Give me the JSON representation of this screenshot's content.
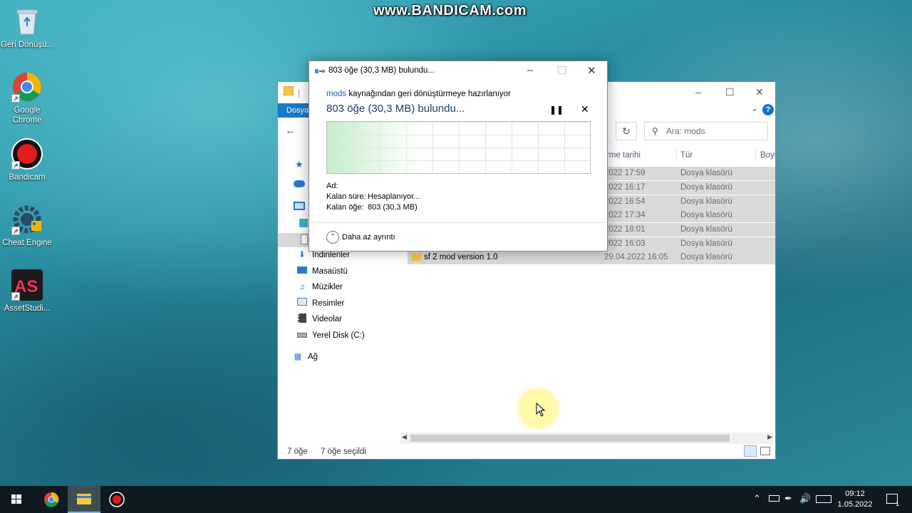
{
  "watermark": "www.BANDICAM.com",
  "desktop": {
    "icons": [
      {
        "label": "Geri Dönüşü...",
        "icon": "recycle-bin-icon"
      },
      {
        "label": "Google Chrome",
        "icon": "chrome-icon"
      },
      {
        "label": "Bandicam",
        "icon": "bandicam-icon"
      },
      {
        "label": "Cheat Engine",
        "icon": "cheat-engine-icon"
      },
      {
        "label": "AssetStudi...",
        "icon": "assetstudio-icon"
      }
    ]
  },
  "explorer": {
    "ribbon_tab": "Dosya",
    "search_placeholder": "Ara: mods",
    "columns": {
      "date": "rme tarihi",
      "type": "Tür",
      "size": "Boyu"
    },
    "rows": [
      {
        "name": "",
        "date": "2022 17:59",
        "type": "Dosya klasörü"
      },
      {
        "name": "",
        "date": "2022 16:17",
        "type": "Dosya klasörü"
      },
      {
        "name": "",
        "date": "2022 16:54",
        "type": "Dosya klasörü"
      },
      {
        "name": "",
        "date": "2022 17:34",
        "type": "Dosya klasörü"
      },
      {
        "name": "",
        "date": "2022 18:01",
        "type": "Dosya klasörü"
      },
      {
        "name": "",
        "date": "2022 16:03",
        "type": "Dosya klasörü"
      },
      {
        "name": "sf 2 mod version 1.0",
        "date": "29.04.2022 16:05",
        "type": "Dosya klasörü"
      }
    ],
    "nav": [
      {
        "label": "İndirilenler",
        "icon": "download-icon"
      },
      {
        "label": "Masaüstü",
        "icon": "desktop-icon"
      },
      {
        "label": "Müzikler",
        "icon": "music-icon"
      },
      {
        "label": "Resimler",
        "icon": "pictures-icon"
      },
      {
        "label": "Videolar",
        "icon": "videos-icon"
      },
      {
        "label": "Yerel Disk (C:)",
        "icon": "disk-icon"
      },
      {
        "label": "Ağ",
        "icon": "network-icon"
      }
    ],
    "status_count": "7 öğe",
    "status_selected": "7 öğe seçildi"
  },
  "dialog": {
    "title": "803 öğe (30,3 MB) bulundu...",
    "source_link": "mods",
    "line1_rest": " kaynağından geri dönüştürmeye hazırlanıyor",
    "headline": "803 öğe (30,3 MB) bulundu...",
    "name_label": "Ad:",
    "remaining_time_label": "Kalan süre:",
    "remaining_time_value": "Hesaplanıyor...",
    "remaining_items_label": "Kalan öğe:",
    "remaining_items_value": "803 (30,3 MB)",
    "less_details": "Daha az ayrıntı"
  },
  "taskbar": {
    "time": "09:12",
    "date": "1.05.2022",
    "notification_badge": "1"
  }
}
